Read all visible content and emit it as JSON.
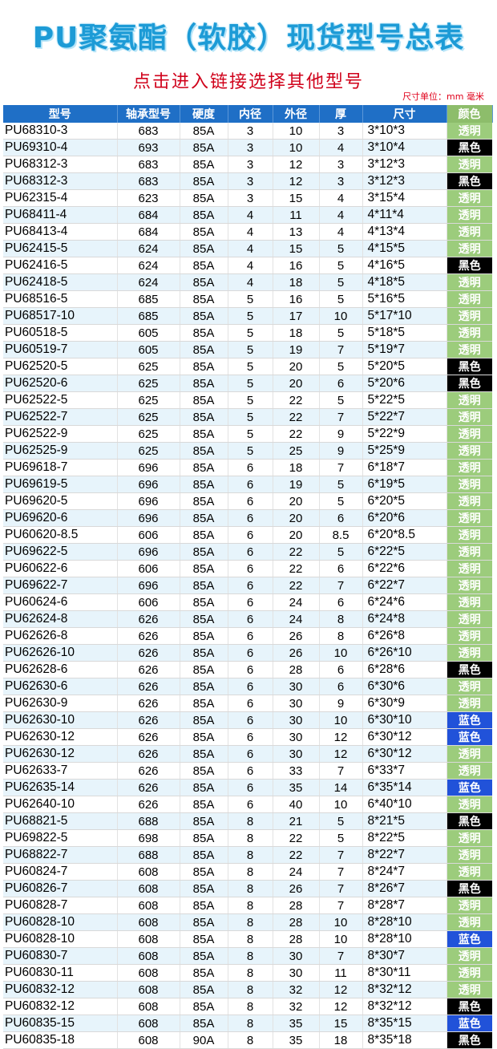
{
  "title": "PU聚氨酯（软胶）现货型号总表",
  "subtitle": "点击进入链接选择其他型号",
  "unit_note": "尺寸单位：mm 毫米",
  "colors": {
    "header_bg": "#1f6fc6",
    "clear": "#9ccc7c",
    "black": "#000000",
    "blue": "#2152d9",
    "title": "#1d9bd6",
    "subtitle": "#d0021b"
  },
  "headers": [
    "型号",
    "轴承型号",
    "硬度",
    "内径",
    "外径",
    "厚",
    "尺寸",
    "颜色"
  ],
  "rows": [
    [
      "PU68310-3",
      "683",
      "85A",
      "3",
      "10",
      "3",
      "3*10*3",
      "透明"
    ],
    [
      "PU69310-4",
      "693",
      "85A",
      "3",
      "10",
      "4",
      "3*10*4",
      "黑色"
    ],
    [
      "PU68312-3",
      "683",
      "85A",
      "3",
      "12",
      "3",
      "3*12*3",
      "透明"
    ],
    [
      "PU68312-3",
      "683",
      "85A",
      "3",
      "12",
      "3",
      "3*12*3",
      "黑色"
    ],
    [
      "PU62315-4",
      "623",
      "85A",
      "3",
      "15",
      "4",
      "3*15*4",
      "透明"
    ],
    [
      "PU68411-4",
      "684",
      "85A",
      "4",
      "11",
      "4",
      "4*11*4",
      "透明"
    ],
    [
      "PU68413-4",
      "684",
      "85A",
      "4",
      "13",
      "4",
      "4*13*4",
      "透明"
    ],
    [
      "PU62415-5",
      "624",
      "85A",
      "4",
      "15",
      "5",
      "4*15*5",
      "透明"
    ],
    [
      "PU62416-5",
      "624",
      "85A",
      "4",
      "16",
      "5",
      "4*16*5",
      "黑色"
    ],
    [
      "PU62418-5",
      "624",
      "85A",
      "4",
      "18",
      "5",
      "4*18*5",
      "透明"
    ],
    [
      "PU68516-5",
      "685",
      "85A",
      "5",
      "16",
      "5",
      "5*16*5",
      "透明"
    ],
    [
      "PU68517-10",
      "685",
      "85A",
      "5",
      "17",
      "10",
      "5*17*10",
      "透明"
    ],
    [
      "PU60518-5",
      "605",
      "85A",
      "5",
      "18",
      "5",
      "5*18*5",
      "透明"
    ],
    [
      "PU60519-7",
      "605",
      "85A",
      "5",
      "19",
      "7",
      "5*19*7",
      "透明"
    ],
    [
      "PU62520-5",
      "625",
      "85A",
      "5",
      "20",
      "5",
      "5*20*5",
      "黑色"
    ],
    [
      "PU62520-6",
      "625",
      "85A",
      "5",
      "20",
      "6",
      "5*20*6",
      "黑色"
    ],
    [
      "PU62522-5",
      "625",
      "85A",
      "5",
      "22",
      "5",
      "5*22*5",
      "透明"
    ],
    [
      "PU62522-7",
      "625",
      "85A",
      "5",
      "22",
      "7",
      "5*22*7",
      "透明"
    ],
    [
      "PU62522-9",
      "625",
      "85A",
      "5",
      "22",
      "9",
      "5*22*9",
      "透明"
    ],
    [
      "PU62525-9",
      "625",
      "85A",
      "5",
      "25",
      "9",
      "5*25*9",
      "透明"
    ],
    [
      "PU69618-7",
      "696",
      "85A",
      "6",
      "18",
      "7",
      "6*18*7",
      "透明"
    ],
    [
      "PU69619-5",
      "696",
      "85A",
      "6",
      "19",
      "5",
      "6*19*5",
      "透明"
    ],
    [
      "PU69620-5",
      "696",
      "85A",
      "6",
      "20",
      "5",
      "6*20*5",
      "透明"
    ],
    [
      "PU69620-6",
      "696",
      "85A",
      "6",
      "20",
      "6",
      "6*20*6",
      "透明"
    ],
    [
      "PU60620-8.5",
      "606",
      "85A",
      "6",
      "20",
      "8.5",
      "6*20*8.5",
      "透明"
    ],
    [
      "PU69622-5",
      "696",
      "85A",
      "6",
      "22",
      "5",
      "6*22*5",
      "透明"
    ],
    [
      "PU60622-6",
      "606",
      "85A",
      "6",
      "22",
      "6",
      "6*22*6",
      "透明"
    ],
    [
      "PU69622-7",
      "696",
      "85A",
      "6",
      "22",
      "7",
      "6*22*7",
      "透明"
    ],
    [
      "PU60624-6",
      "606",
      "85A",
      "6",
      "24",
      "6",
      "6*24*6",
      "透明"
    ],
    [
      "PU62624-8",
      "626",
      "85A",
      "6",
      "24",
      "8",
      "6*24*8",
      "透明"
    ],
    [
      "PU62626-8",
      "626",
      "85A",
      "6",
      "26",
      "8",
      "6*26*8",
      "透明"
    ],
    [
      "PU62626-10",
      "626",
      "85A",
      "6",
      "26",
      "10",
      "6*26*10",
      "透明"
    ],
    [
      "PU62628-6",
      "626",
      "85A",
      "6",
      "28",
      "6",
      "6*28*6",
      "黑色"
    ],
    [
      "PU62630-6",
      "626",
      "85A",
      "6",
      "30",
      "6",
      "6*30*6",
      "透明"
    ],
    [
      "PU62630-9",
      "626",
      "85A",
      "6",
      "30",
      "9",
      "6*30*9",
      "透明"
    ],
    [
      "PU62630-10",
      "626",
      "85A",
      "6",
      "30",
      "10",
      "6*30*10",
      "蓝色"
    ],
    [
      "PU62630-12",
      "626",
      "85A",
      "6",
      "30",
      "12",
      "6*30*12",
      "蓝色"
    ],
    [
      "PU62630-12",
      "626",
      "85A",
      "6",
      "30",
      "12",
      "6*30*12",
      "透明"
    ],
    [
      "PU62633-7",
      "626",
      "85A",
      "6",
      "33",
      "7",
      "6*33*7",
      "透明"
    ],
    [
      "PU62635-14",
      "626",
      "85A",
      "6",
      "35",
      "14",
      "6*35*14",
      "蓝色"
    ],
    [
      "PU62640-10",
      "626",
      "85A",
      "6",
      "40",
      "10",
      "6*40*10",
      "透明"
    ],
    [
      "PU68821-5",
      "688",
      "85A",
      "8",
      "21",
      "5",
      "8*21*5",
      "黑色"
    ],
    [
      "PU69822-5",
      "698",
      "85A",
      "8",
      "22",
      "5",
      "8*22*5",
      "透明"
    ],
    [
      "PU68822-7",
      "688",
      "85A",
      "8",
      "22",
      "7",
      "8*22*7",
      "透明"
    ],
    [
      "PU60824-7",
      "608",
      "85A",
      "8",
      "24",
      "7",
      "8*24*7",
      "透明"
    ],
    [
      "PU60826-7",
      "608",
      "85A",
      "8",
      "26",
      "7",
      "8*26*7",
      "黑色"
    ],
    [
      "PU60828-7",
      "608",
      "85A",
      "8",
      "28",
      "7",
      "8*28*7",
      "透明"
    ],
    [
      "PU60828-10",
      "608",
      "85A",
      "8",
      "28",
      "10",
      "8*28*10",
      "透明"
    ],
    [
      "PU60828-10",
      "608",
      "85A",
      "8",
      "28",
      "10",
      "8*28*10",
      "蓝色"
    ],
    [
      "PU60830-7",
      "608",
      "85A",
      "8",
      "30",
      "7",
      "8*30*7",
      "透明"
    ],
    [
      "PU60830-11",
      "608",
      "85A",
      "8",
      "30",
      "11",
      "8*30*11",
      "透明"
    ],
    [
      "PU60832-12",
      "608",
      "85A",
      "8",
      "32",
      "12",
      "8*32*12",
      "透明"
    ],
    [
      "PU60832-12",
      "608",
      "85A",
      "8",
      "32",
      "12",
      "8*32*12",
      "黑色"
    ],
    [
      "PU60835-15",
      "608",
      "85A",
      "8",
      "35",
      "15",
      "8*35*15",
      "蓝色"
    ],
    [
      "PU60835-18",
      "608",
      "90A",
      "8",
      "35",
      "18",
      "8*35*18",
      "黑色"
    ]
  ]
}
